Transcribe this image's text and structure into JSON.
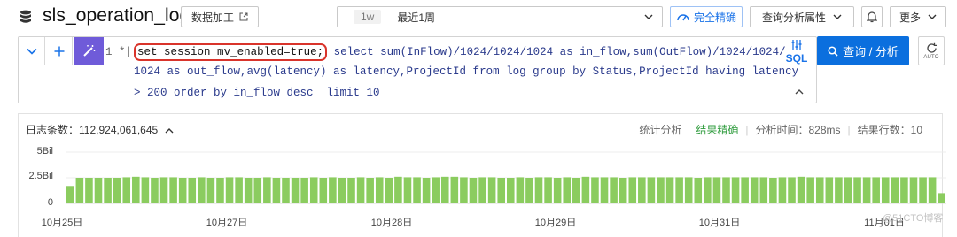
{
  "header": {
    "logstore_name": "sls_operation_log",
    "data_process_label": "数据加工",
    "time_range": {
      "quick_tag": "1w",
      "label": "最近1周"
    },
    "exact_label": "完全精确",
    "query_props_label": "查询分析属性",
    "more_label": "更多"
  },
  "query": {
    "line_number": "1",
    "prefix": "*|",
    "highlighted": "set session mv_enabled=true;",
    "line1_rest": " select sum(InFlow)/1024/1024/1024 as in_flow,sum(OutFlow)/1024/1024/",
    "line2": "1024 as out_flow,avg(latency) as latency,ProjectId from log group by Status,ProjectId having latency",
    "line3": "> 200 order by in_flow desc  limit 10",
    "sql_toggle_label": "SQL",
    "search_button_label": "查询 / 分析",
    "auto_label": "AUTO"
  },
  "results": {
    "log_count_label": "日志条数：112,924,061,645",
    "stats": {
      "analysis": "统计分析",
      "result_exact": "结果精确",
      "analysis_time": "分析时间：828ms",
      "result_rows": "结果行数：10"
    }
  },
  "chart_data": {
    "type": "bar",
    "y_ticks": [
      "5Bil",
      "2.5Bil",
      "0"
    ],
    "ylim": [
      0,
      5
    ],
    "y_unit": "Bil",
    "x_ticks": [
      "10月25日",
      "10月27日",
      "10月28日",
      "10月29日",
      "10月31日",
      "11月01日"
    ],
    "values": [
      1.7,
      2.5,
      2.5,
      2.5,
      2.5,
      2.5,
      2.55,
      2.6,
      2.55,
      2.5,
      2.55,
      2.55,
      2.5,
      2.5,
      2.55,
      2.5,
      2.5,
      2.55,
      2.55,
      2.5,
      2.5,
      2.55,
      2.5,
      2.5,
      2.5,
      2.5,
      2.55,
      2.5,
      2.55,
      2.5,
      2.5,
      2.55,
      2.5,
      2.55,
      2.5,
      2.6,
      2.55,
      2.55,
      2.5,
      2.55,
      2.6,
      2.6,
      2.55,
      2.5,
      2.55,
      2.55,
      2.5,
      2.5,
      2.55,
      2.5,
      2.55,
      2.55,
      2.5,
      2.55,
      2.5,
      2.6,
      2.55,
      2.55,
      2.55,
      2.5,
      2.55,
      2.55,
      2.55,
      2.55,
      2.55,
      2.55,
      2.55,
      2.5,
      2.55,
      2.55,
      2.55,
      2.55,
      2.55,
      2.55,
      2.55,
      2.5,
      2.55,
      2.55,
      2.6,
      2.55,
      2.55,
      2.55,
      2.55,
      2.55,
      2.55,
      2.55,
      2.55,
      2.55,
      2.55,
      2.55,
      2.55,
      2.55,
      2.55,
      1.0
    ],
    "bar_color": "#8bcc5f",
    "grid": true
  },
  "colors": {
    "accent": "#0b6fde",
    "success": "#2e9b3c",
    "highlight_border": "#d9342b",
    "magic_button": "#6f5bd9"
  },
  "watermark": "@51CTO博客"
}
